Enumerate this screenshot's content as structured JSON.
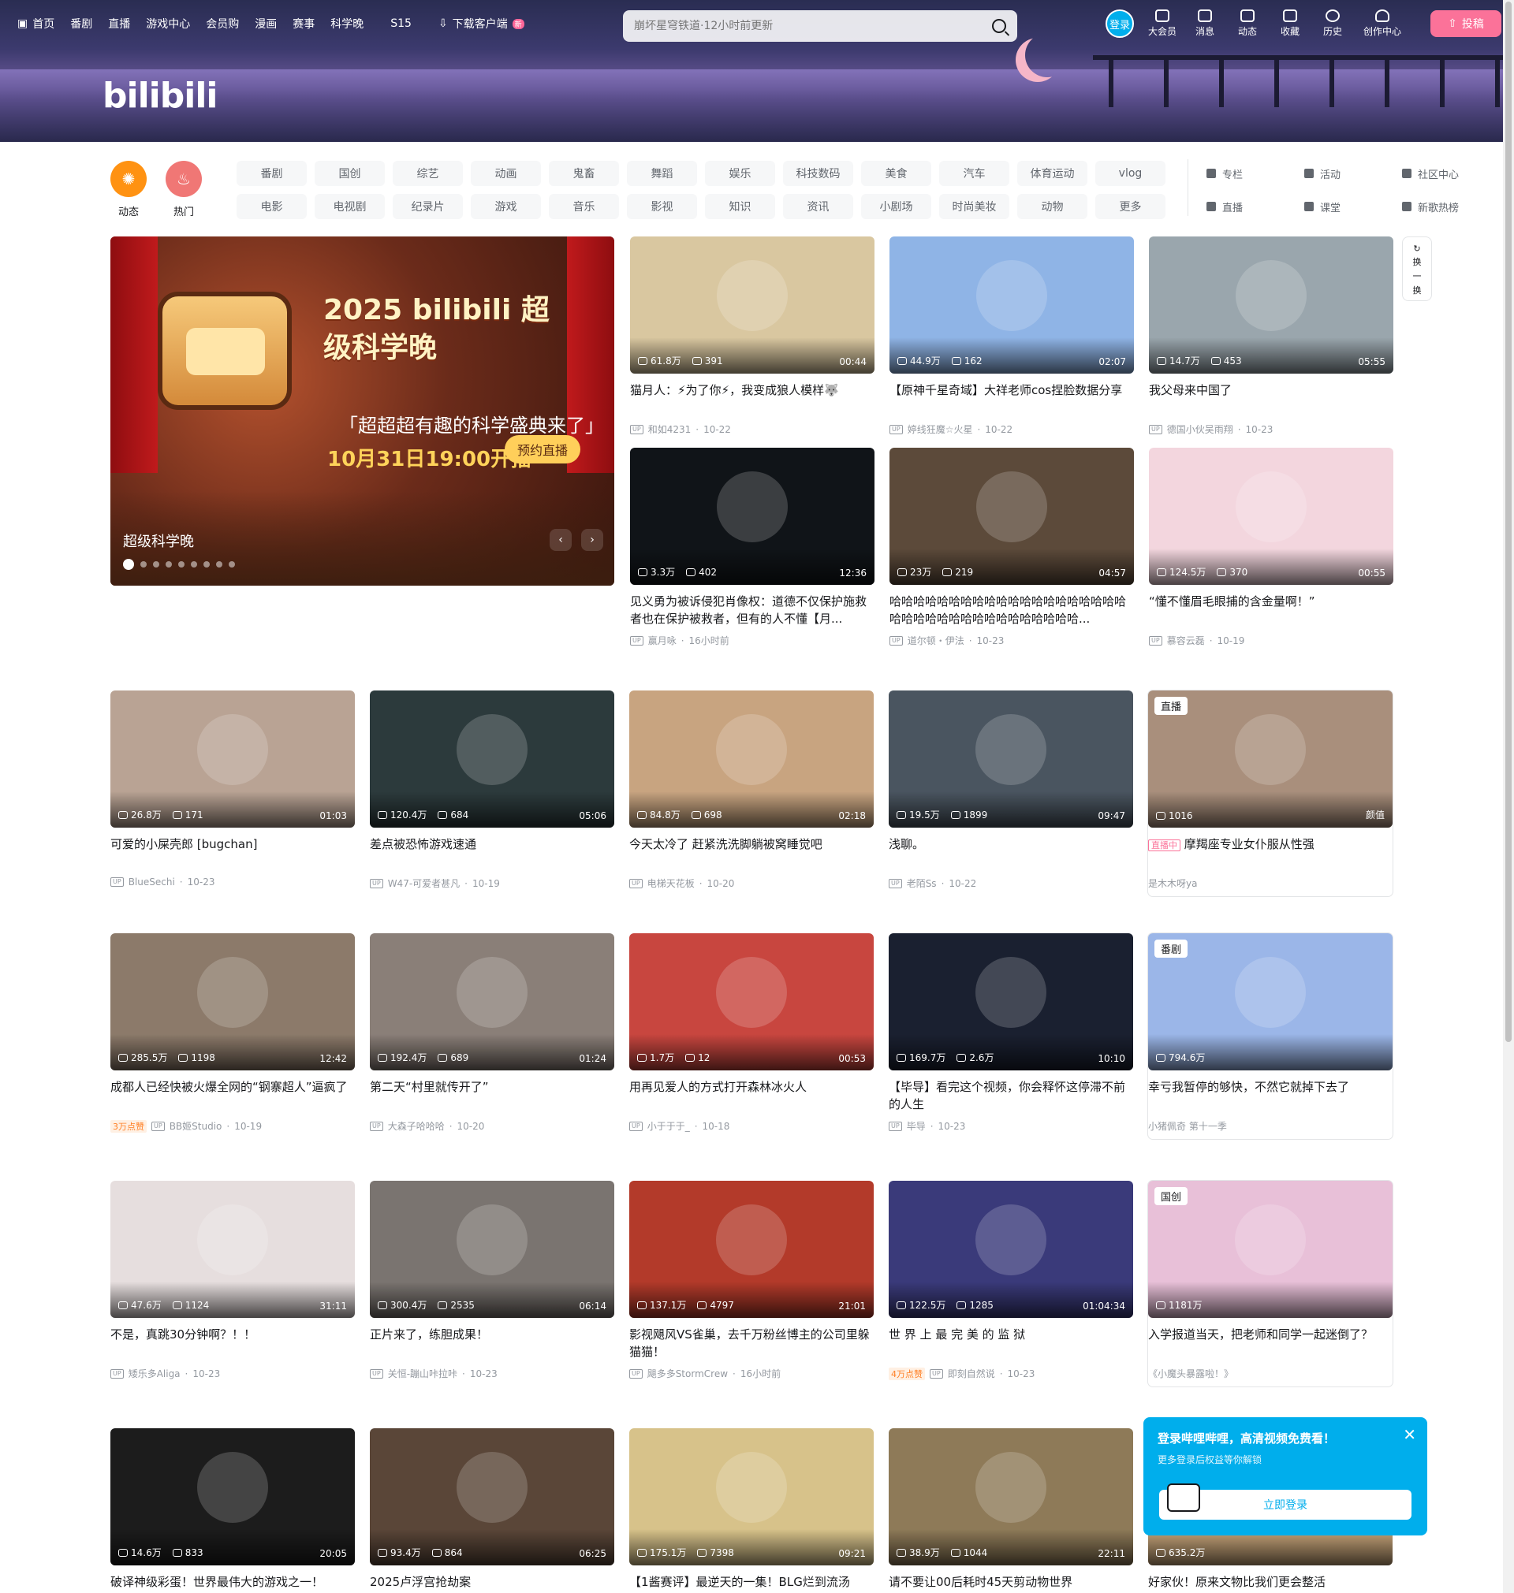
{
  "topnav": {
    "items": [
      "首页",
      "番剧",
      "直播",
      "游戏中心",
      "会员购",
      "漫画",
      "赛事",
      "科学晚",
      "S15",
      "下载客户端"
    ],
    "download_badge": "新"
  },
  "search": {
    "placeholder": "崩坏星穹铁道·12小时前更新"
  },
  "login": "登录",
  "rightnav": [
    "大会员",
    "消息",
    "动态",
    "收藏",
    "历史",
    "创作中心"
  ],
  "upload": "投稿",
  "logo": "bilibili",
  "round_channels": [
    {
      "label": "动态",
      "color": "#ff9212"
    },
    {
      "label": "热门",
      "color": "#f07775"
    }
  ],
  "channels": [
    "番剧",
    "国创",
    "综艺",
    "动画",
    "鬼畜",
    "舞蹈",
    "娱乐",
    "科技数码",
    "美食",
    "汽车",
    "体育运动",
    "vlog",
    "电影",
    "电视剧",
    "纪录片",
    "游戏",
    "音乐",
    "影视",
    "知识",
    "资讯",
    "小剧场",
    "时尚美妆",
    "动物",
    "更多"
  ],
  "tools": [
    "专栏",
    "活动",
    "社区中心",
    "直播",
    "课堂",
    "新歌热榜"
  ],
  "carousel": {
    "title": "超级科学晚",
    "headline": "2025 bilibili 超级科学晚",
    "subline": "「超超超有趣的科学盛典来了」",
    "time": "10月31日19:00开播",
    "button": "预约直播",
    "dots": 9
  },
  "refresh": [
    "换",
    "一",
    "换"
  ],
  "cards": [
    {
      "views": "61.8万",
      "danmaku": "391",
      "dur": "00:44",
      "title": "猫月人：⚡为了你⚡，我变成狼人模样🐺",
      "up": "和如4231",
      "date": "10-22",
      "bg": "#d9c7a0"
    },
    {
      "views": "44.9万",
      "danmaku": "162",
      "dur": "02:07",
      "title": "【原神千星奇域】大祥老师cos捏脸数据分享",
      "up": "婷线狂魔☆火星",
      "date": "10-22",
      "bg": "#8fb4e6"
    },
    {
      "views": "14.7万",
      "danmaku": "453",
      "dur": "05:55",
      "title": "我父母来中国了",
      "up": "德国小伙吴雨翔",
      "date": "10-23",
      "bg": "#9aa6ad"
    },
    {
      "views": "3.3万",
      "danmaku": "402",
      "dur": "12:36",
      "title": "见义勇为被诉侵犯肖像权：道德不仅保护施救者也在保护被救者，但有的人不懂【月...",
      "up": "赢月咏",
      "date": "16小时前",
      "bg": "#101418"
    },
    {
      "views": "23万",
      "danmaku": "219",
      "dur": "04:57",
      "title": "哈哈哈哈哈哈哈哈哈哈哈哈哈哈哈哈哈哈哈哈哈哈哈哈哈哈哈哈哈哈哈哈哈哈哈哈...",
      "up": "道尔顿・伊法",
      "date": "10-23",
      "bg": "#5c4a3a"
    },
    {
      "views": "124.5万",
      "danmaku": "370",
      "dur": "00:55",
      "title": "“懂不懂眉毛眼捕的含金量啊！”",
      "up": "慕容云磊",
      "date": "10-19",
      "bg": "#f3d6de"
    },
    {
      "views": "26.8万",
      "danmaku": "171",
      "dur": "01:03",
      "title": "可爱的小屎壳郎 [bugchan]",
      "up": "BlueSechi",
      "date": "10-23",
      "bg": "#b9a394"
    },
    {
      "views": "120.4万",
      "danmaku": "684",
      "dur": "05:06",
      "title": "差点被恐怖游戏速通",
      "up": "W47-可爱者甚凡",
      "date": "10-19",
      "bg": "#2c3a3c"
    },
    {
      "views": "84.8万",
      "danmaku": "698",
      "dur": "02:18",
      "title": "今天太冷了 赶紧洗洗脚躺被窝睡觉吧",
      "up": "电梯天花板",
      "date": "10-20",
      "bg": "#c8a480"
    },
    {
      "views": "19.5万",
      "danmaku": "1899",
      "dur": "09:47",
      "title": "浅聊。",
      "up": "老陌Ss",
      "date": "10-22",
      "bg": "#4a5560"
    },
    {
      "views": "1016",
      "danmaku": "",
      "dur": "颜值",
      "title": "摩羯座专业女仆服从性强",
      "up": "是木木呀ya",
      "date": "",
      "bg": "#a98f7c",
      "tag": "直播",
      "live": "直播中"
    },
    {
      "views": "285.5万",
      "danmaku": "1198",
      "dur": "12:42",
      "title": "成都人已经快被火爆全网的“钢寨超人”逼疯了",
      "up": "BB姬Studio",
      "date": "10-19",
      "bg": "#8c7a6a",
      "like": "3万点赞"
    },
    {
      "views": "192.4万",
      "danmaku": "689",
      "dur": "01:24",
      "title": "第二天“村里就传开了”",
      "up": "大森子哈哈哈",
      "date": "10-20",
      "bg": "#8a7f78"
    },
    {
      "views": "1.7万",
      "danmaku": "12",
      "dur": "00:53",
      "title": "用再见爱人的方式打开森林冰火人",
      "up": "小于于于_",
      "date": "10-18",
      "bg": "#c8463f"
    },
    {
      "views": "169.7万",
      "danmaku": "2.6万",
      "dur": "10:10",
      "title": "【毕导】看完这个视频，你会释怀这停滞不前的人生",
      "up": "毕导",
      "date": "10-23",
      "bg": "#1a2030"
    },
    {
      "views": "794.6万",
      "danmaku": "",
      "dur": "",
      "title": "幸亏我暂停的够快，不然它就掉下去了",
      "up": "小猪佩奇 第十一季",
      "date": "",
      "bg": "#9bb6e8",
      "tag": "番剧"
    },
    {
      "views": "47.6万",
      "danmaku": "1124",
      "dur": "31:11",
      "title": "不是，真跳30分钟啊？！！",
      "up": "矮乐多Aliga",
      "date": "10-23",
      "bg": "#e6dede"
    },
    {
      "views": "300.4万",
      "danmaku": "2535",
      "dur": "06:14",
      "title": "正片来了，练胆成果！",
      "up": "关恒-蹦山咔拉咔",
      "date": "10-23",
      "bg": "#7a7470"
    },
    {
      "views": "137.1万",
      "danmaku": "4797",
      "dur": "21:01",
      "title": "影视飓风VS雀巢，去千万粉丝博主的公司里躲猫猫！",
      "up": "飓多多StormCrew",
      "date": "16小时前",
      "bg": "#b33a2a"
    },
    {
      "views": "122.5万",
      "danmaku": "1285",
      "dur": "01:04:34",
      "title": "世 界 上 最 完 美 的 监 狱",
      "up": "即刻自然说",
      "date": "10-23",
      "bg": "#3a3a7a",
      "like": "4万点赞"
    },
    {
      "views": "1181万",
      "danmaku": "",
      "dur": "",
      "title": "入学报道当天，把老师和同学一起迷倒了？",
      "up": "《小魔头暴露啦！》",
      "date": "",
      "bg": "#e8c0d8",
      "tag": "国创"
    },
    {
      "views": "14.6万",
      "danmaku": "833",
      "dur": "20:05",
      "title": "破译神级彩蛋！世界最伟大的游戏之一！",
      "up": "",
      "date": "",
      "bg": "#1c1c1c"
    },
    {
      "views": "93.4万",
      "danmaku": "864",
      "dur": "06:25",
      "title": "2025卢浮宫抢劫案",
      "up": "",
      "date": "",
      "bg": "#5a4638"
    },
    {
      "views": "175.1万",
      "danmaku": "7398",
      "dur": "09:21",
      "title": "【1酱赛评】最逆天的一集！BLG烂到流汤",
      "up": "",
      "date": "",
      "bg": "#d7c28a"
    },
    {
      "views": "38.9万",
      "danmaku": "1044",
      "dur": "22:11",
      "title": "请不要让00后耗时45天剪动物世界",
      "up": "",
      "date": "",
      "bg": "#8e7a58"
    },
    {
      "views": "635.2万",
      "danmaku": "",
      "dur": "",
      "title": "好家伙！原来文物比我们更会整活",
      "up": "",
      "date": "",
      "bg": "#c9a67a"
    }
  ],
  "popup": {
    "title": "登录哔哩哔哩，高清视频免费看！",
    "sub": "更多登录后权益等你解锁",
    "button": "立即登录"
  }
}
